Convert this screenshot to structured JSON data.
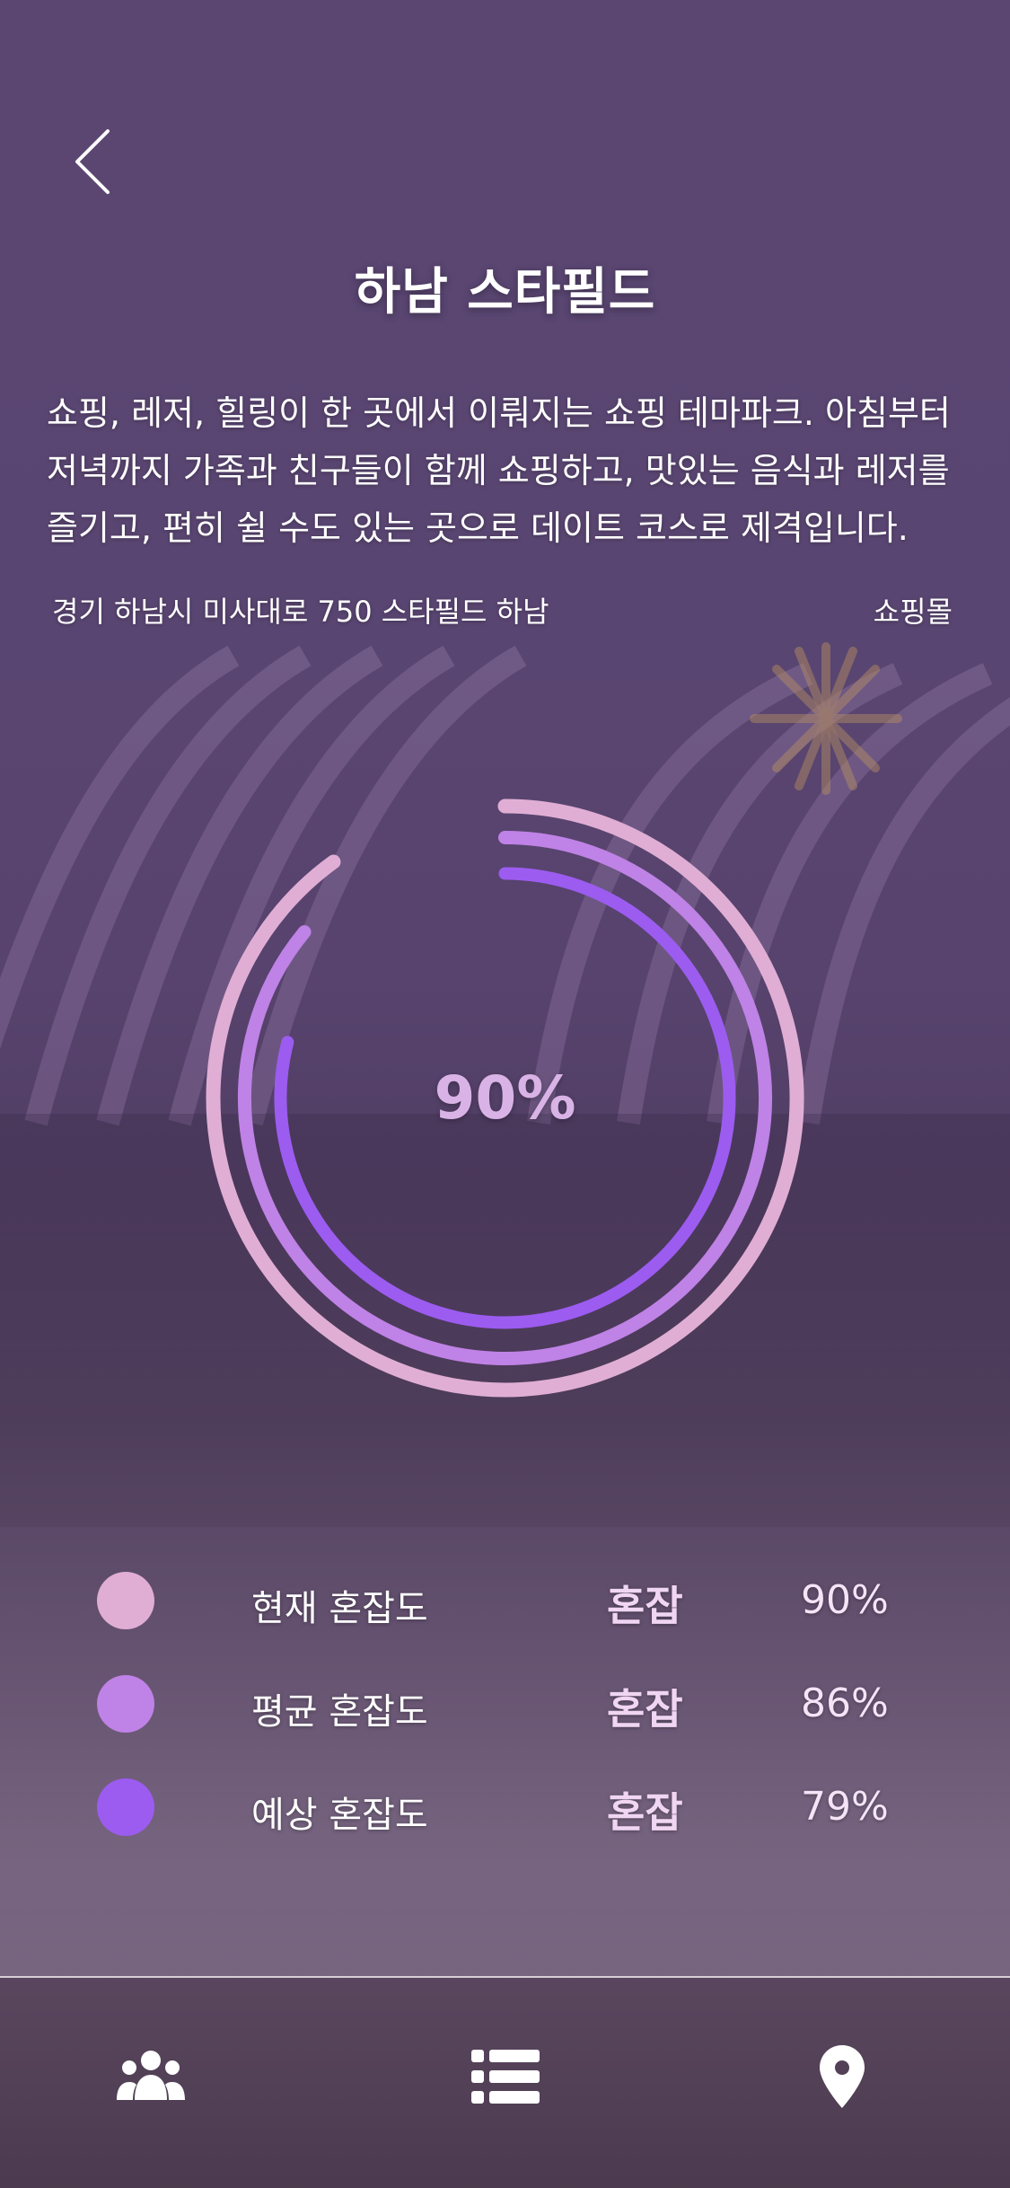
{
  "header": {
    "title": "하남 스타필드",
    "back_icon": "chevron-left-icon"
  },
  "place": {
    "description": "쇼핑, 레저, 힐링이 한 곳에서 이뤄지는 쇼핑 테마파크. 아침부터 저녁까지 가족과 친구들이 함께 쇼핑하고, 맛있는 음식과 레저를 즐기고, 편히 쉴 수도 있는 곳으로 데이트 코스로 제격입니다.",
    "address": "경기 하남시 미사대로 750 스타필드 하남",
    "category": "쇼핑몰"
  },
  "chart_data": {
    "type": "radial-progress",
    "center_label": "90%",
    "series": [
      {
        "name": "현재 혼잡도",
        "value": 90,
        "color": "#e0aed4"
      },
      {
        "name": "평균 혼잡도",
        "value": 86,
        "color": "#bf82e6"
      },
      {
        "name": "예상 혼잡도",
        "value": 79,
        "color": "#9c5cf0"
      }
    ],
    "max": 100
  },
  "legend": [
    {
      "label": "현재 혼잡도",
      "status": "혼잡",
      "percent": "90%",
      "color": "#e0aed4"
    },
    {
      "label": "평균 혼잡도",
      "status": "혼잡",
      "percent": "86%",
      "color": "#bf82e6"
    },
    {
      "label": "예상 혼잡도",
      "status": "혼잡",
      "percent": "79%",
      "color": "#9c5cf0"
    }
  ],
  "colors": {
    "status_text": "#f0d6f2",
    "percent_text": "#f5e3f7"
  },
  "navbar": {
    "items": [
      {
        "icon": "people-icon"
      },
      {
        "icon": "list-icon"
      },
      {
        "icon": "location-pin-icon"
      }
    ]
  }
}
